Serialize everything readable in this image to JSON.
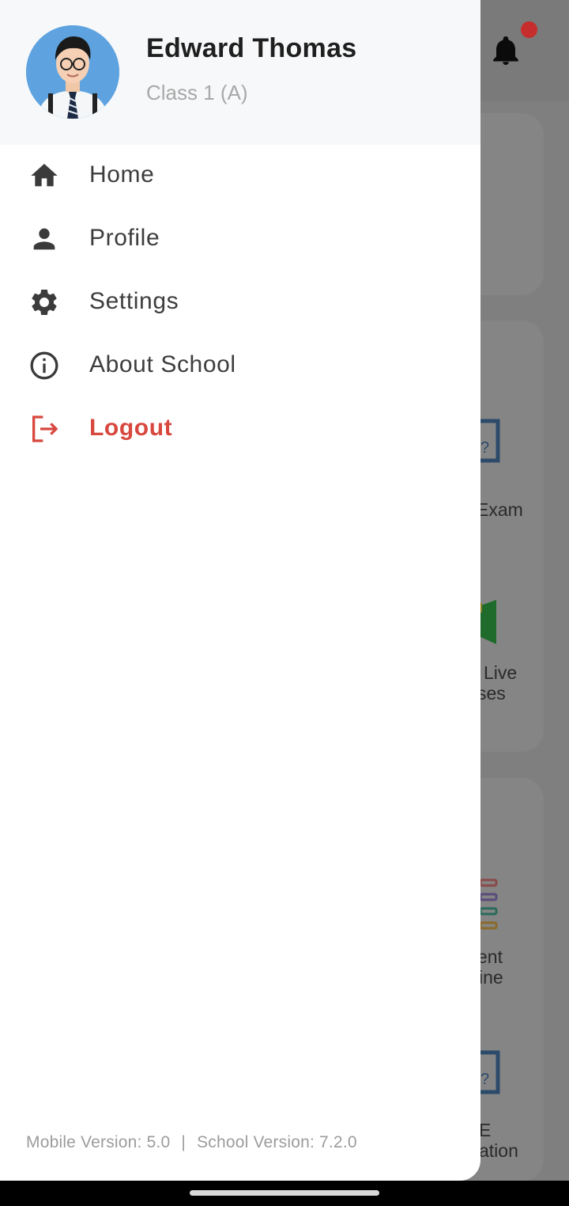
{
  "drawer": {
    "user_name": "Edward Thomas",
    "user_class": "Class 1 (A)",
    "menu": [
      {
        "label": "Home",
        "icon": "home-icon"
      },
      {
        "label": "Profile",
        "icon": "person-icon"
      },
      {
        "label": "Settings",
        "icon": "gear-icon"
      },
      {
        "label": "About School",
        "icon": "info-icon"
      },
      {
        "label": "Logout",
        "icon": "logout-icon"
      }
    ],
    "footer": {
      "mobile_version": "Mobile Version: 5.0",
      "separator": "|",
      "school_version": "School Version: 7.2.0"
    }
  },
  "background": {
    "labels": [
      "Exam",
      "Live",
      "ses",
      "ent",
      "ine",
      "E",
      "ation"
    ]
  },
  "colors": {
    "accent_logout": "#d8483f",
    "notification_dot": "#c62d2d",
    "header_bg": "#f7f8f9"
  }
}
